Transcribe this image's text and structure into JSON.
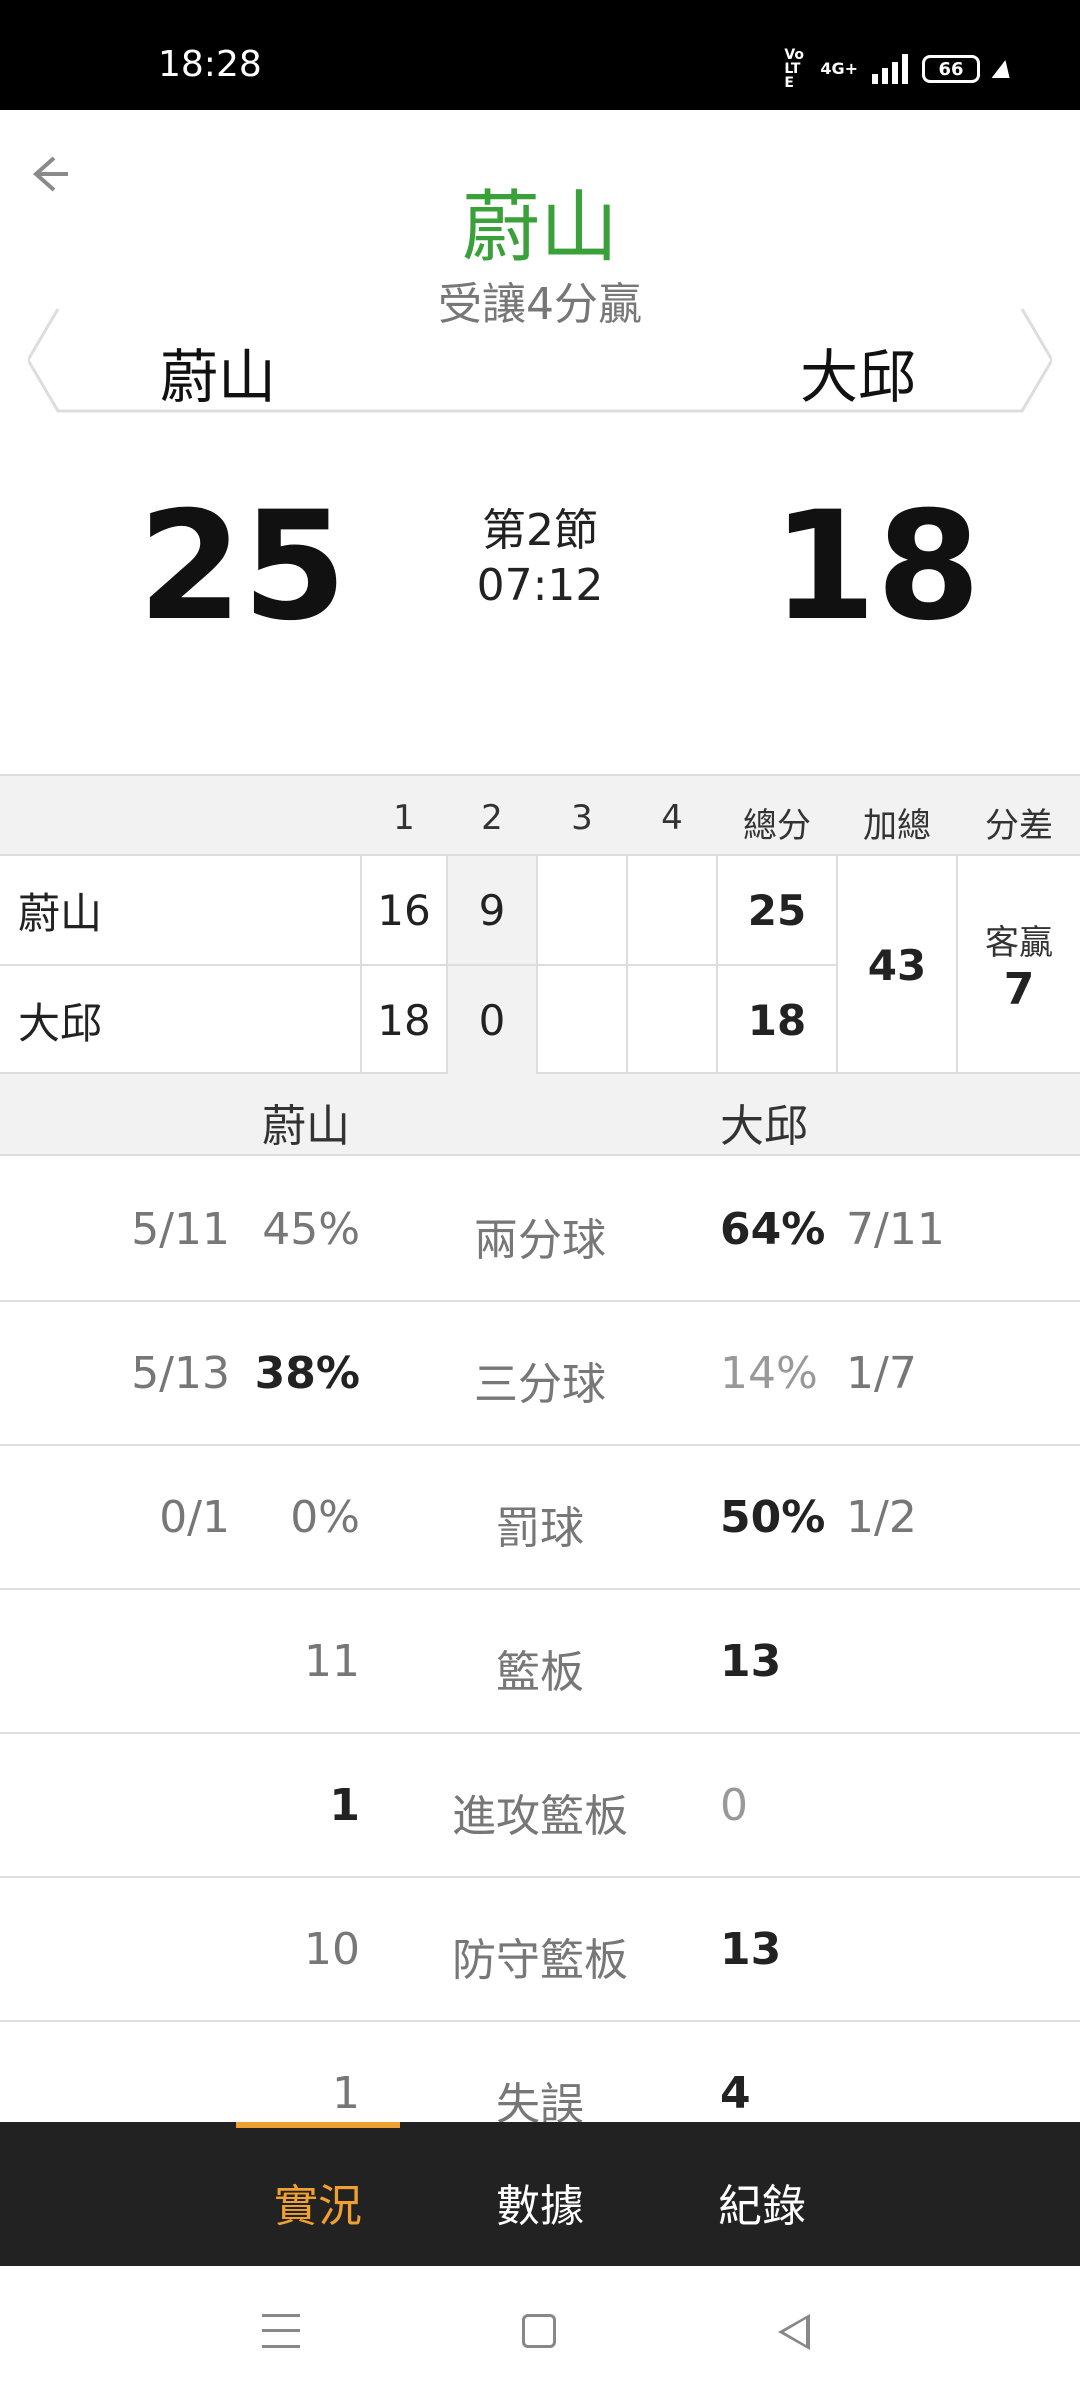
{
  "status_bar": {
    "time": "18:28",
    "volte": "Vo LTE",
    "network": "4G+",
    "battery": "66"
  },
  "header": {
    "leader_team": "蔚山",
    "handicap_text": "受讓4分贏",
    "home_team": "蔚山",
    "away_team": "大邱",
    "home_score": "25",
    "away_score": "18",
    "period": "第2節",
    "clock": "07:12"
  },
  "quarter_table": {
    "headers": [
      "1",
      "2",
      "3",
      "4",
      "總分",
      "加總",
      "分差"
    ],
    "rows": [
      {
        "team": "蔚山",
        "q1": "16",
        "q2": "9",
        "q3": "",
        "q4": "",
        "total": "25"
      },
      {
        "team": "大邱",
        "q1": "18",
        "q2": "0",
        "q3": "",
        "q4": "",
        "total": "18"
      }
    ],
    "combined_total": "43",
    "diff_label": "客贏",
    "diff_value": "7"
  },
  "stats": {
    "home_team": "蔚山",
    "away_team": "大邱",
    "rows": [
      {
        "label": "兩分球",
        "home_frac": "5/11",
        "home_val": "45%",
        "away_val": "64%",
        "away_frac": "7/11"
      },
      {
        "label": "三分球",
        "home_frac": "5/13",
        "home_val": "38%",
        "away_val": "14%",
        "away_frac": "1/7"
      },
      {
        "label": "罰球",
        "home_frac": "0/1",
        "home_val": "0%",
        "away_val": "50%",
        "away_frac": "1/2"
      },
      {
        "label": "籃板",
        "home_frac": "",
        "home_val": "11",
        "away_val": "13",
        "away_frac": ""
      },
      {
        "label": "進攻籃板",
        "home_frac": "",
        "home_val": "1",
        "away_val": "0",
        "away_frac": ""
      },
      {
        "label": "防守籃板",
        "home_frac": "",
        "home_val": "10",
        "away_val": "13",
        "away_frac": ""
      },
      {
        "label": "失誤",
        "home_frac": "",
        "home_val": "1",
        "away_val": "4",
        "away_frac": ""
      }
    ]
  },
  "tabs": {
    "live": "實況",
    "data": "數據",
    "record": "紀錄"
  },
  "colors": {
    "leader_green": "#3aa13a",
    "tab_accent": "#f0a030",
    "tabbar_bg": "#222222"
  },
  "icons": {
    "back": "arrow-left-icon",
    "nav_menu": "menu-icon",
    "nav_home": "home-square-icon",
    "nav_back": "triangle-back-icon"
  }
}
